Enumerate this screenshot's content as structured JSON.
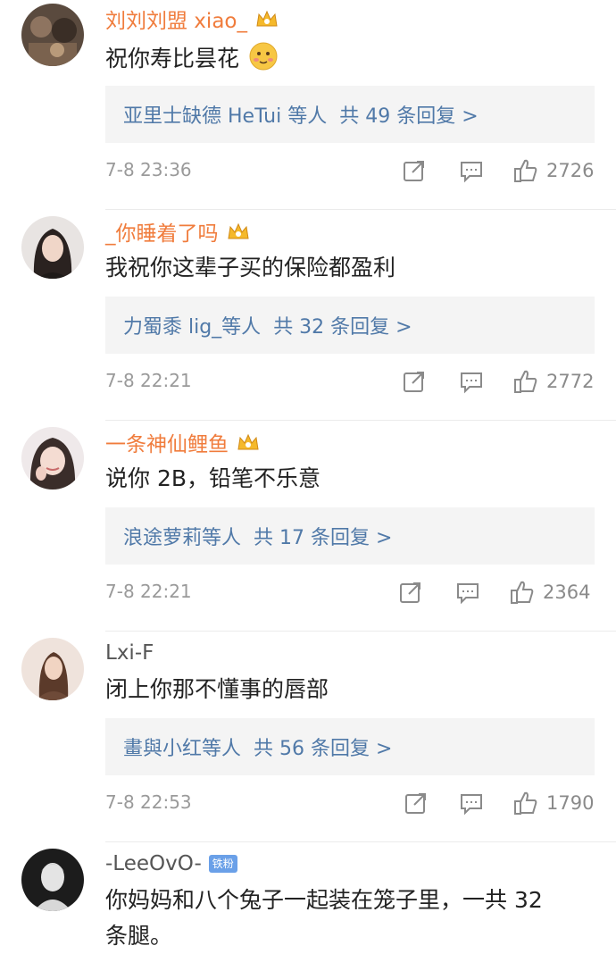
{
  "comments": [
    {
      "username": "刘刘刘盟 xiao_",
      "text": "祝你寿比昙花",
      "replies": {
        "users": "亚里士缺德 HeTui 等人",
        "count": "共 49 条回复 >"
      },
      "time": "7-8 23:36",
      "likes": "2726"
    },
    {
      "username": "_你睡着了吗",
      "text": "我祝你这辈子买的保险都盈利",
      "replies": {
        "users": "力蜀黍 lig_等人",
        "count": "共 32 条回复 >"
      },
      "time": "7-8 22:21",
      "likes": "2772"
    },
    {
      "username": "一条神仙鲤鱼",
      "text": "说你 2B，铅笔不乐意",
      "replies": {
        "users": "浪途萝莉等人",
        "count": "共 17 条回复 >"
      },
      "time": "7-8 22:21",
      "likes": "2364"
    },
    {
      "username": "Lxi-F",
      "text": "闭上你那不懂事的唇部",
      "replies": {
        "users": "畫與小红等人",
        "count": "共 56 条回复 >"
      },
      "time": "7-8 22:53",
      "likes": "1790"
    },
    {
      "username": "-LeeOvO-",
      "badge": "铁粉",
      "text_line1": "你妈妈和八个兔子一起装在笼子里，一共 32",
      "text_line2": "条腿。"
    }
  ],
  "icons": {
    "crown_badge": "crown-badge-icon",
    "share": "share-icon",
    "reply": "comment-icon",
    "like": "thumbs-up-icon",
    "emoji": "blush-emoji-icon"
  },
  "colors": {
    "vip_username": "#f07c3c",
    "plain_username": "#555555",
    "reply_link": "#5079a8",
    "meta": "#9a9a9a",
    "reply_box": "#f4f4f4"
  }
}
